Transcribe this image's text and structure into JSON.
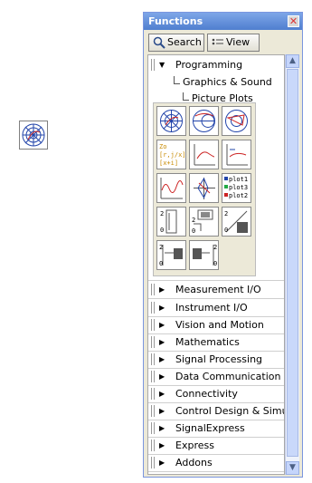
{
  "palette": {
    "title": "Functions",
    "toolbar": {
      "search_label": "Search",
      "view_label": "View"
    },
    "tree": {
      "programming": "Programming",
      "graphics_sound": "Graphics & Sound",
      "picture_plots": "Picture Plots",
      "categories": [
        "Measurement I/O",
        "Instrument I/O",
        "Vision and Motion",
        "Mathematics",
        "Signal Processing",
        "Data Communication",
        "Connectivity",
        "Control Design & Simulation",
        "SignalExpress",
        "Express",
        "Addons"
      ]
    },
    "vi_icons": [
      {
        "name": "polar-plot-icon"
      },
      {
        "name": "smith-plot-icon"
      },
      {
        "name": "radar-plot-icon"
      },
      {
        "name": "data-icon",
        "text": [
          "Zo",
          "[r,j/x]",
          "[x+i]"
        ]
      },
      {
        "name": "xy-plot-icon"
      },
      {
        "name": "scatter-plot-icon"
      },
      {
        "name": "waveform-plot-icon"
      },
      {
        "name": "polar-chart-icon"
      },
      {
        "name": "legend-plot-icon",
        "text": [
          "plot1",
          "plot3",
          "plot2"
        ]
      },
      {
        "name": "cluster-icon"
      },
      {
        "name": "picture-to-pixmap-icon"
      },
      {
        "name": "array-picture-icon"
      },
      {
        "name": "index-to-array-icon"
      },
      {
        "name": "array-to-pixmap-icon"
      }
    ]
  },
  "colors": {
    "titlebar": "#4f7fcf",
    "palette_bg": "#ece9d8",
    "accent_red": "#cc2222",
    "accent_blue": "#2244aa"
  }
}
